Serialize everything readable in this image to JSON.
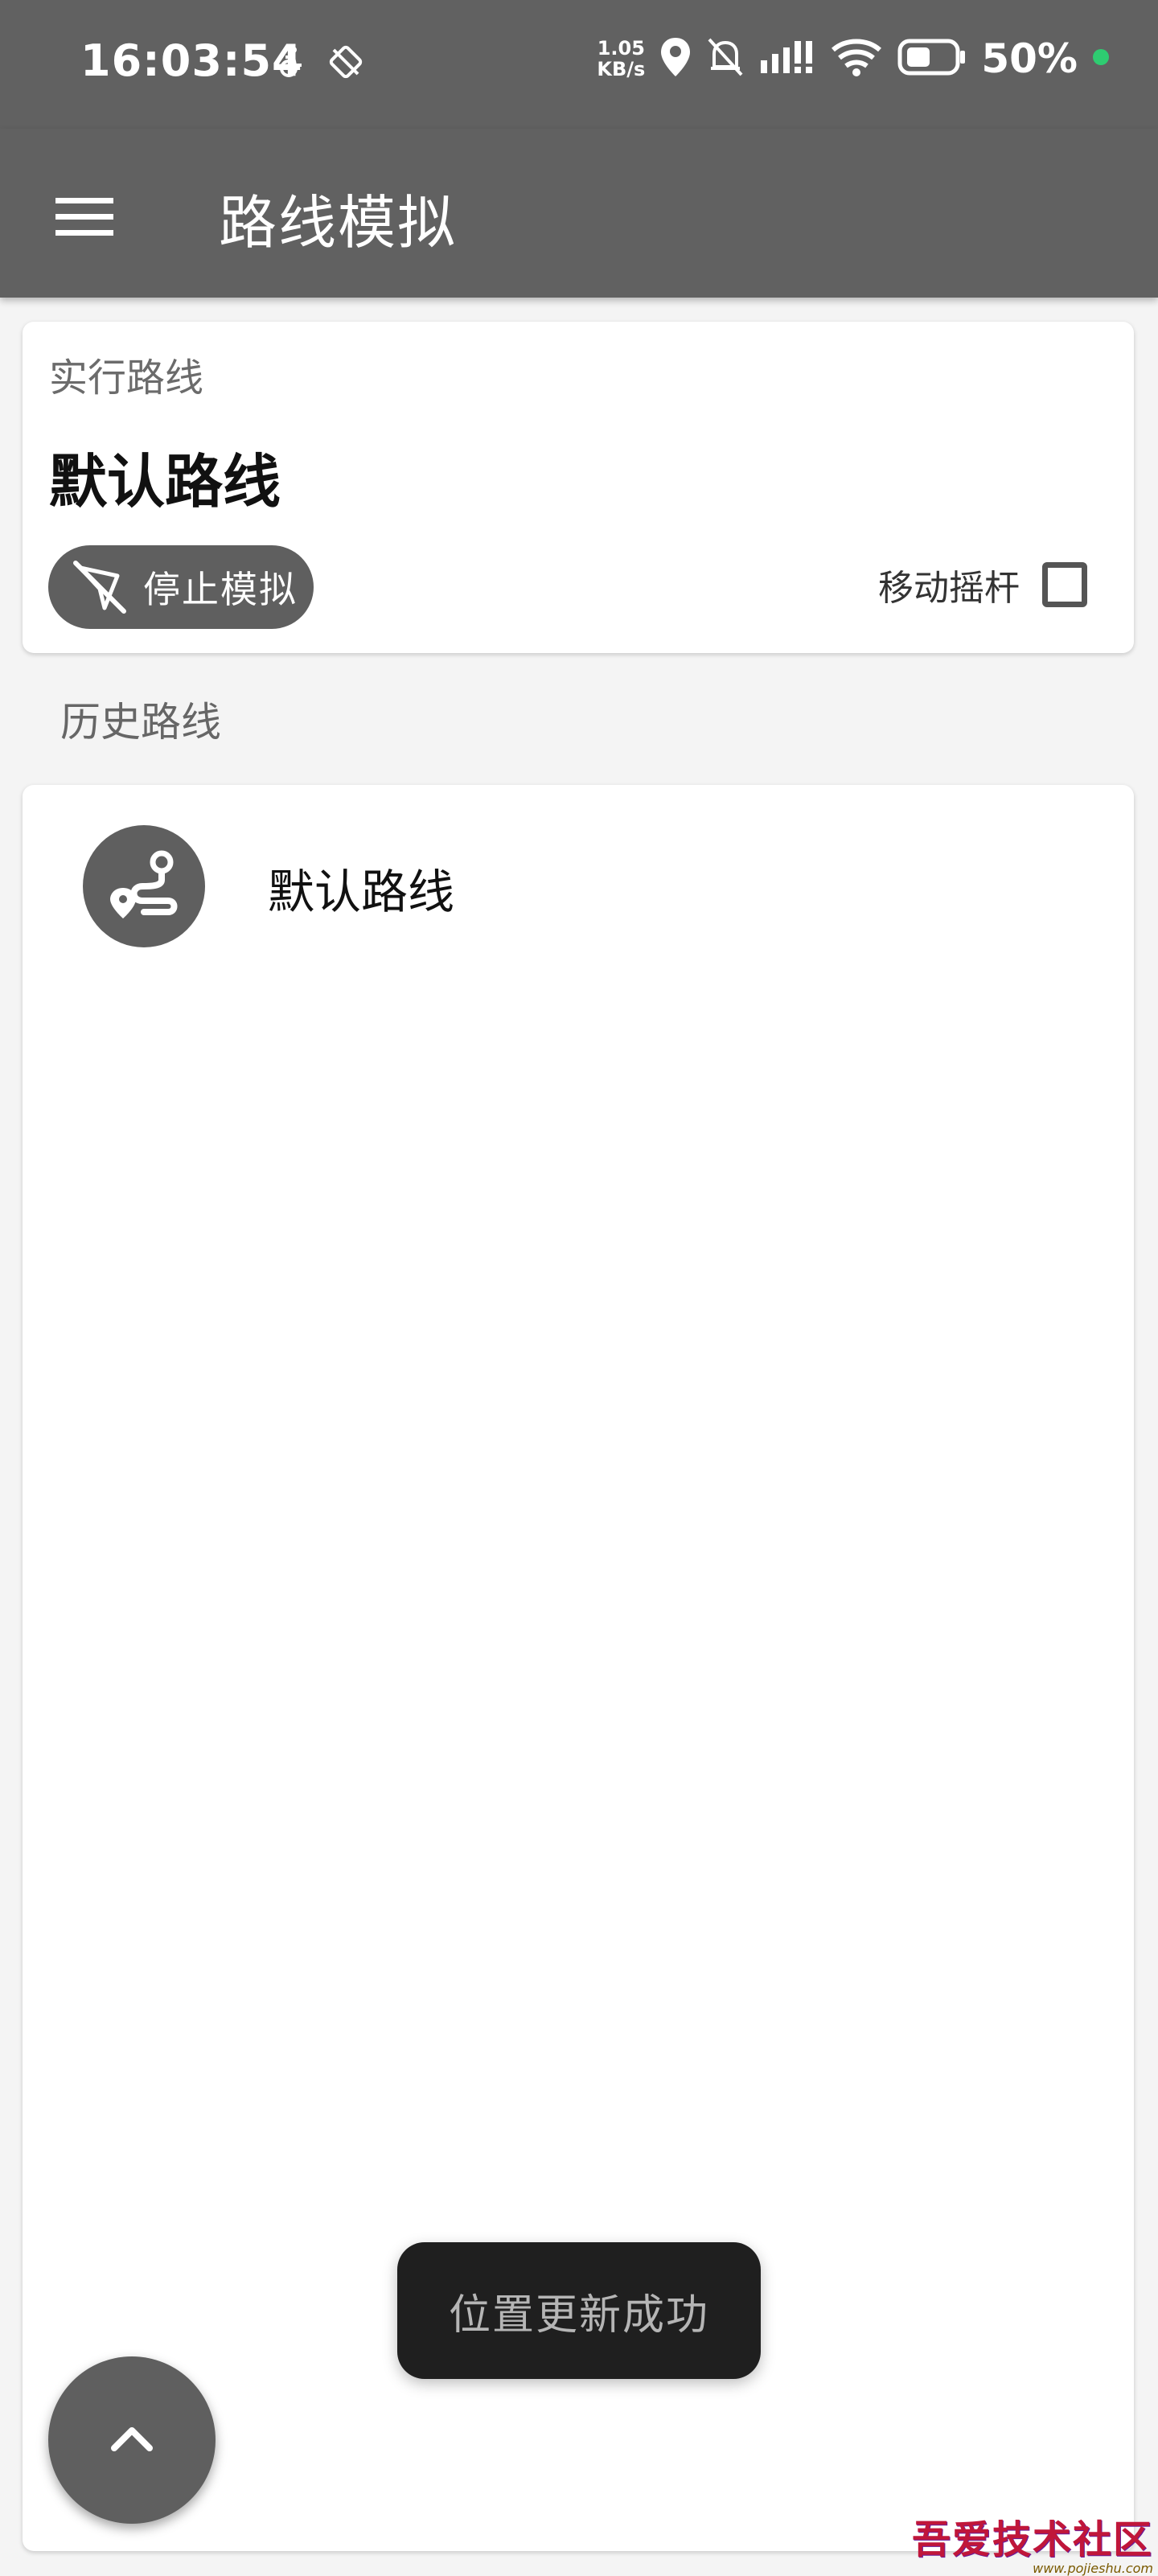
{
  "status_bar": {
    "time": "16:03:54",
    "speed_value": "1.05",
    "speed_unit": "KB/s",
    "battery": "50%",
    "icons": [
      "accessibility-icon",
      "sync-off-icon",
      "location-icon",
      "bell-off-icon",
      "signal-icon",
      "wifi-icon",
      "battery-icon",
      "privacy-dot-icon"
    ]
  },
  "app_bar": {
    "menu_icon": "hamburger-menu-icon",
    "title": "路线模拟"
  },
  "current_route": {
    "label": "实行路线",
    "name": "默认路线",
    "stop_button_label": "停止模拟",
    "stop_icon": "location-off-icon",
    "joystick_label": "移动摇杆",
    "joystick_checked": false
  },
  "history": {
    "label": "历史路线",
    "items": [
      {
        "name": "默认路线",
        "icon": "route-icon"
      }
    ]
  },
  "toast": {
    "text": "位置更新成功"
  },
  "fab": {
    "icon": "chevron-up-icon"
  },
  "watermark": {
    "text": "吾爱技术社区",
    "url": "www.pojieshu.com"
  },
  "colors": {
    "primary": "#616161",
    "background": "#f4f4f4",
    "card": "#ffffff",
    "toast_bg": "#1f1f1f",
    "privacy_dot": "#2ecc71"
  }
}
